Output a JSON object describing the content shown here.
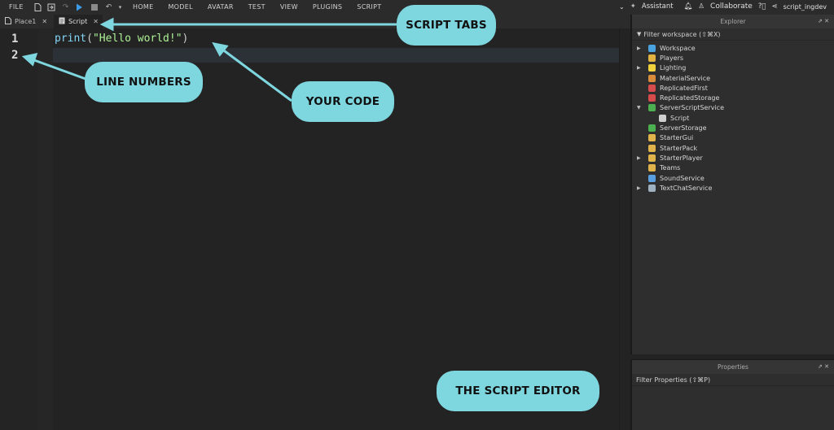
{
  "topbar": {
    "file": "FILE",
    "menus": [
      "HOME",
      "MODEL",
      "AVATAR",
      "TEST",
      "VIEW",
      "PLUGINS",
      "SCRIPT"
    ],
    "assistant": "Assistant",
    "collaborate": "Collaborate",
    "username": "script_ingdev"
  },
  "tabs": [
    {
      "label": "Place1",
      "icon": "place-icon"
    },
    {
      "label": "Script",
      "icon": "script-icon"
    }
  ],
  "editor": {
    "line_numbers": [
      "1",
      "2"
    ],
    "code": {
      "fn": "print",
      "open": "(",
      "str": "\"Hello world!\"",
      "close": ")"
    }
  },
  "explorer": {
    "title": "Explorer",
    "filter": "Filter workspace (⇧⌘X)",
    "items": [
      {
        "label": "Workspace",
        "expandable": true,
        "color": "#4aa3df"
      },
      {
        "label": "Players",
        "expandable": false,
        "color": "#e3b341"
      },
      {
        "label": "Lighting",
        "expandable": true,
        "color": "#f2d23c"
      },
      {
        "label": "MaterialService",
        "expandable": false,
        "color": "#d98c3c"
      },
      {
        "label": "ReplicatedFirst",
        "expandable": false,
        "color": "#d64b4b"
      },
      {
        "label": "ReplicatedStorage",
        "expandable": false,
        "color": "#d64b4b"
      },
      {
        "label": "ServerScriptService",
        "expandable": true,
        "expanded": true,
        "color": "#4caf50"
      },
      {
        "label": "Script",
        "expandable": false,
        "child": true,
        "color": "#cfcfcf"
      },
      {
        "label": "ServerStorage",
        "expandable": false,
        "color": "#4caf50"
      },
      {
        "label": "StarterGui",
        "expandable": false,
        "color": "#e0b44a"
      },
      {
        "label": "StarterPack",
        "expandable": false,
        "color": "#e0b44a"
      },
      {
        "label": "StarterPlayer",
        "expandable": true,
        "color": "#e0b44a"
      },
      {
        "label": "Teams",
        "expandable": false,
        "color": "#e0b44a"
      },
      {
        "label": "SoundService",
        "expandable": false,
        "color": "#5aa0e0"
      },
      {
        "label": "TextChatService",
        "expandable": true,
        "color": "#9fb0c0"
      }
    ]
  },
  "properties": {
    "title": "Properties",
    "filter": "Filter Properties (⇧⌘P)"
  },
  "callouts": {
    "script_tabs": "SCRIPT TABS",
    "line_numbers": "LINE NUMBERS",
    "your_code": "YOUR CODE",
    "script_editor": "THE SCRIPT EDITOR"
  },
  "colors": {
    "callout": "#7ed6df",
    "editor_bg": "#232323",
    "keyword": "#84d6f7",
    "string": "#adf195"
  }
}
